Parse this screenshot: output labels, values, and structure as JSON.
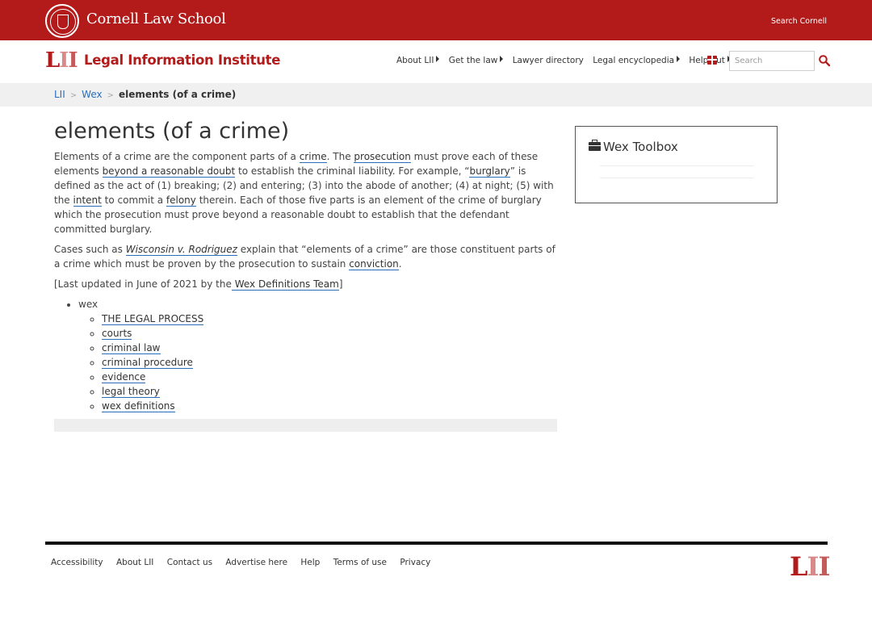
{
  "cornell": {
    "name": "Cornell Law School",
    "search_link": "Search Cornell"
  },
  "lii": {
    "logo_letters": [
      "L",
      "I",
      "I"
    ],
    "title": "Legal Information Institute"
  },
  "nav": {
    "items": [
      {
        "label": "About LII",
        "has_caret": true
      },
      {
        "label": "Get the law",
        "has_caret": true
      },
      {
        "label": "Lawyer directory",
        "has_caret": false
      },
      {
        "label": "Legal encyclopedia",
        "has_caret": true
      },
      {
        "label": "Help out",
        "has_caret": true
      }
    ],
    "search_placeholder": "Search",
    "colors": {
      "brand": "#b31b1b",
      "link_underline": "#2a6ebb"
    }
  },
  "breadcrumb": {
    "items": [
      "LII",
      "Wex"
    ],
    "separator": ">",
    "current": "elements (of a crime)"
  },
  "article": {
    "title": "elements (of a crime)",
    "p1": {
      "t1": "Elements of a crime are the component parts of a ",
      "l1": "crime",
      "t2": ". The ",
      "l2": "prosecution",
      "t3": " must prove each of these elements ",
      "l3": "beyond a reasonable doubt",
      "t4": " to establish the criminal liability. For example, “",
      "l4": "burglary",
      "t5": "” is defined as the act of (1) breaking; (2) and entering; (3) into the abode of another; (4) at night; (5) with the ",
      "l5": "intent",
      "t6": " to commit a ",
      "l6": "felony",
      "t7": " therein. Each of those five parts is an element of the crime of burglary which the prosecution must prove beyond a reasonable doubt to establish that the defendant committed burglary."
    },
    "p2": {
      "t1": "Cases such as ",
      "l1": "Wisconsin v. Rodriguez",
      "t2": " explain that “elements of a crime” are those constituent parts of a crime which must be proven by the prosecution to sustain ",
      "l2": "conviction",
      "t3": "."
    },
    "updated": {
      "t1": "[Last updated in June of 2021 by the",
      "l1": " Wex Definitions Team",
      "t2": "]"
    },
    "topics": {
      "label": "wex",
      "items": [
        "THE LEGAL PROCESS",
        "courts",
        "criminal law",
        "criminal procedure",
        "evidence",
        "legal theory",
        "wex definitions"
      ]
    }
  },
  "toolbox": {
    "icon": "briefcase-icon",
    "title": "Wex Toolbox"
  },
  "footer": {
    "links": [
      "Accessibility",
      "About LII",
      "Contact us",
      "Advertise here",
      "Help",
      "Terms of use",
      "Privacy"
    ],
    "logo_letters": [
      "L",
      "I",
      "I"
    ]
  }
}
